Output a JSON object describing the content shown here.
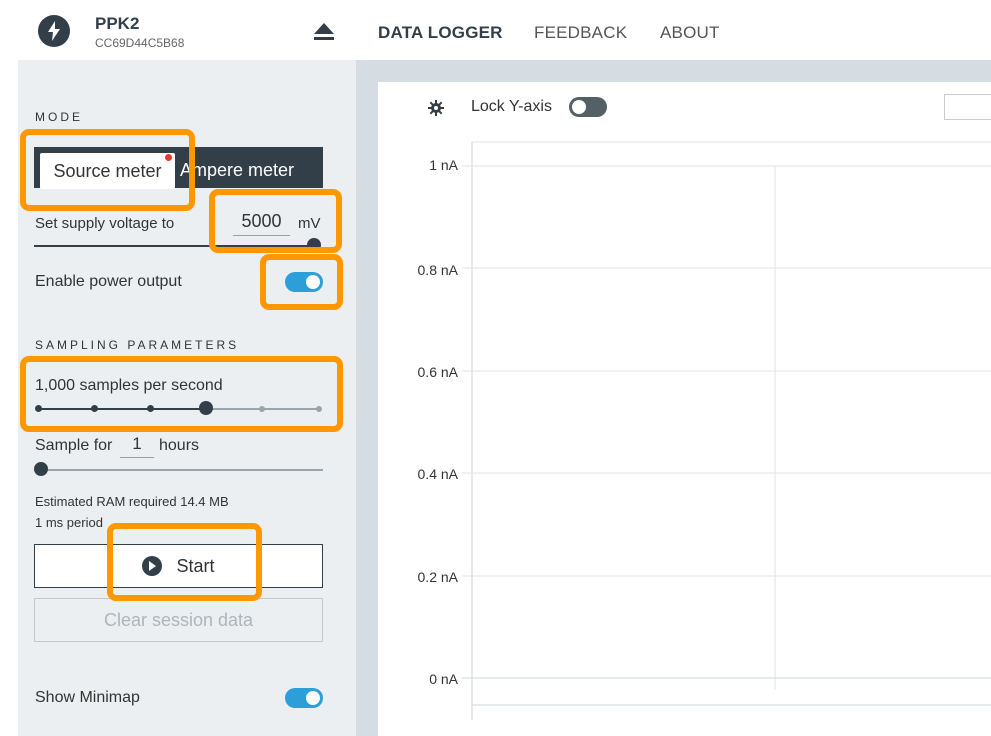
{
  "device": {
    "name": "PPK2",
    "serial": "CC69D44C5B68",
    "icon": "lightning-icon",
    "eject_icon": "eject-icon"
  },
  "nav": {
    "items": [
      {
        "label": "DATA LOGGER",
        "active": true
      },
      {
        "label": "FEEDBACK",
        "active": false
      },
      {
        "label": "ABOUT",
        "active": false
      }
    ]
  },
  "sidebar": {
    "mode": {
      "title": "MODE",
      "source_meter": "Source meter",
      "ampere_meter": "Ampere meter",
      "supply_label": "Set supply voltage to",
      "supply_value": "5000",
      "supply_unit": "mV",
      "power_label": "Enable power output",
      "power_enabled": true
    },
    "sampling": {
      "title": "SAMPLING PARAMETERS",
      "rate_label": "1,000 samples per second",
      "rate_steps": 6,
      "rate_selected_index": 3,
      "sample_for_label": "Sample for",
      "sample_for_value": "1",
      "sample_for_unit": "hours",
      "ram_text": "Estimated RAM required 14.4 MB",
      "period_text": "1 ms period"
    },
    "start_label": "Start",
    "clear_label": "Clear session data",
    "minimap_label": "Show Minimap",
    "minimap_enabled": true
  },
  "chart": {
    "lock_label": "Lock Y-axis",
    "lock_enabled": false,
    "y_ticks": [
      "1 nA",
      "0.8 nA",
      "0.6 nA",
      "0.4 nA",
      "0.2 nA",
      "0 nA"
    ]
  },
  "colors": {
    "accent": "#2c9fd8",
    "dark": "#333f48",
    "highlight": "#ff9800",
    "sidebar_bg": "#eceff1",
    "chart_bg": "#d6dde2"
  }
}
